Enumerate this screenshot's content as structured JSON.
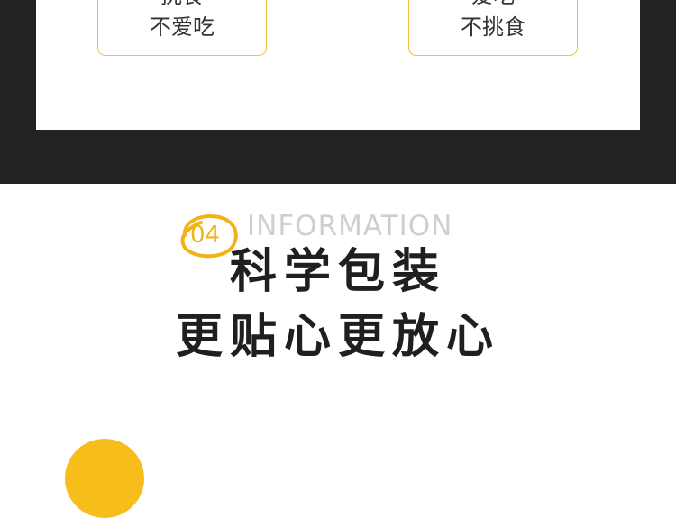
{
  "top_labels": [
    {
      "line1": "挑食",
      "line2": "不爱吃"
    },
    {
      "line1": "爱吃",
      "line2": "不挑食"
    }
  ],
  "section": {
    "number": "04",
    "info": "INFORMATION",
    "headline_1": "科学包装",
    "headline_2": "更贴心更放心"
  },
  "colors": {
    "dark_band": "#222222",
    "accent": "#f3c233",
    "headline": "#1f1f1f",
    "info_gray": "#cfcfcf"
  }
}
